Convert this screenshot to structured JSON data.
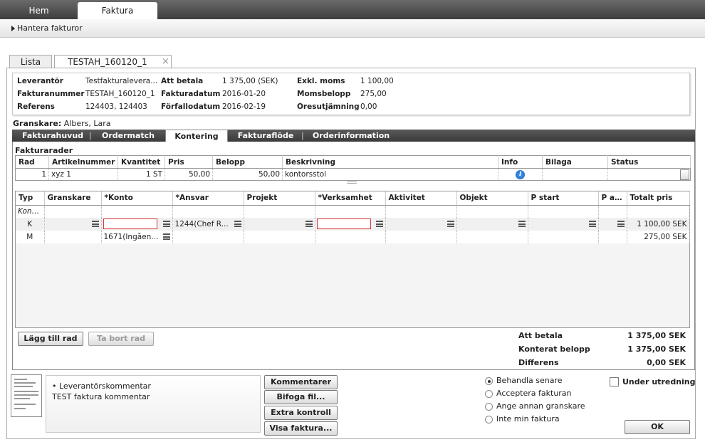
{
  "top_tabs": {
    "hem": "Hem",
    "faktura": "Faktura"
  },
  "subnav": {
    "label": "Hantera fakturor"
  },
  "doc_tabs": {
    "lista": "Lista",
    "current": "TESTAH_160120_1",
    "close": "×"
  },
  "info": {
    "leverantor_label": "Leverantör",
    "leverantor_value": "Testfakturalevera...",
    "fakturanummer_label": "Fakturanummer",
    "fakturanummer_value": "TESTAH_160120_1",
    "referens_label": "Referens",
    "referens_value": "124403, 124403",
    "att_betala_label": "Att betala",
    "att_betala_value": "1 375,00 (SEK)",
    "fakturadatum_label": "Fakturadatum",
    "fakturadatum_value": "2016-01-20",
    "forfallodatum_label": "Förfallodatum",
    "forfallodatum_value": "2016-02-19",
    "exkl_moms_label": "Exkl. moms",
    "exkl_moms_value": "1 100,00",
    "momsbelopp_label": "Momsbelopp",
    "momsbelopp_value": "275,00",
    "oresutjamning_label": "Öresutjämning",
    "oresutjamning_value": "0,00"
  },
  "granskare": {
    "label": "Granskare:",
    "value": "Albers, Lara"
  },
  "inner_tabs": [
    "Fakturahuvud",
    "Ordermatch",
    "Kontering",
    "Fakturaflöde",
    "Orderinformation"
  ],
  "fakturarader": {
    "title": "Fakturarader",
    "headers": [
      "Rad",
      "Artikelnummer",
      "Kvantitet",
      "Pris",
      "Belopp",
      "Beskrivning",
      "Info",
      "Bilaga",
      "Status"
    ],
    "row": {
      "rad": "1",
      "artikel": "xyz 1",
      "kvantitet": "1 ST",
      "pris": "50,00",
      "belopp": "50,00",
      "beskrivning": "kontorsstol"
    }
  },
  "kontering": {
    "headers": [
      "Typ",
      "Granskare",
      "*Konto",
      "*Ansvar",
      "Projekt",
      "*Verksamhet",
      "Aktivitet",
      "Objekt",
      "P start",
      "P anta",
      "Totalt pris"
    ],
    "row0": {
      "typ": "Kont..."
    },
    "row1": {
      "typ": "K",
      "ansvar": "1244(Chef R...",
      "totalt": "1 100,00 SEK"
    },
    "row2": {
      "typ": "M",
      "konto": "1671(Ingåen...",
      "totalt": "275,00 SEK"
    }
  },
  "buttons": {
    "add_row": "Lägg till rad",
    "remove_row": "Ta bort rad",
    "kommentarer": "Kommentarer",
    "bifoga": "Bifoga fil...",
    "extra": "Extra kontroll",
    "visa": "Visa faktura...",
    "ok": "OK"
  },
  "summary": {
    "att_betala_label": "Att betala",
    "att_betala_value": "1 375,00 SEK",
    "konterat_label": "Konterat belopp",
    "konterat_value": "1 375,00 SEK",
    "differens_label": "Differens",
    "differens_value": "0,00 SEK"
  },
  "comment": {
    "heading": "• Leverantörskommentar",
    "text": "TEST faktura kommentar"
  },
  "actions": {
    "behandla": "Behandla senare",
    "acceptera": "Acceptera fakturan",
    "annan": "Ange annan granskare",
    "inte_min": "Inte min faktura",
    "selected": "Behandla senare"
  },
  "under_utredning": {
    "label": "Under utredning",
    "checked": false
  },
  "colors": {
    "topbar": "#3e3e3e",
    "invalid_border": "#d33",
    "info_icon": "#1a6fd0"
  }
}
